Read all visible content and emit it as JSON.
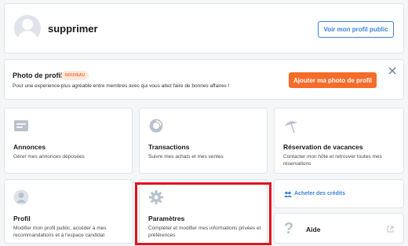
{
  "header": {
    "username": "supprimer",
    "view_profile_button": "Voir mon profil public"
  },
  "banner": {
    "title": "Photo de profil",
    "badge": "NOUVEAU",
    "text": "Pour une experience plus agréable entre membres avec qui vous allez faire de bonnes affaires !",
    "button": "Ajouter ma photo de profil"
  },
  "tiles": [
    {
      "title": "Annonces",
      "desc": "Gérer mes annonces déposées"
    },
    {
      "title": "Transactions",
      "desc": "Suivre mes achats et mes ventes"
    },
    {
      "title": "Réservation de vacances",
      "desc": "Contacter mon hôte et retrouver toutes mes réservations"
    },
    {
      "title": "Profil",
      "desc": "Modifier mon profil public, accéder à mes recommandations et à l'espace candidat"
    },
    {
      "title": "Paramètres",
      "desc": "Compléter et modifier mes informations privées et préférences"
    }
  ],
  "credits": {
    "label": "Acheter des crédits"
  },
  "aide": {
    "label": "Aide"
  },
  "colors": {
    "accent_orange": "#f56b2a",
    "link_blue": "#4183d7",
    "highlight_red": "#e1141c"
  }
}
